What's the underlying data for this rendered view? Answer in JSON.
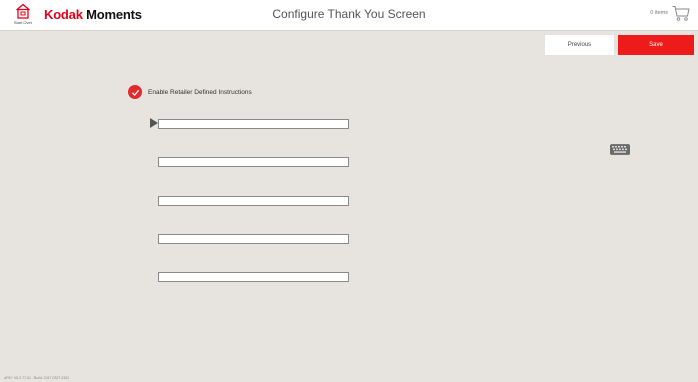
{
  "header": {
    "start_over_label": "Start Over",
    "brand_kodak": "Kodak",
    "brand_moments": "Moments",
    "title": "Configure Thank You Screen",
    "cart_count": "0 items"
  },
  "actions": {
    "previous_label": "Previous",
    "save_label": "Save"
  },
  "form": {
    "enable_label": "Enable Retailer Defined Instructions",
    "enable_checked": true,
    "instructions": [
      {
        "value": ""
      },
      {
        "value": ""
      },
      {
        "value": ""
      },
      {
        "value": ""
      },
      {
        "value": ""
      }
    ]
  },
  "footer": {
    "build_info": "APK+ V6.2.77.01 - Build: 2017.0327.2302"
  },
  "colors": {
    "accent": "#ee1b1b",
    "background": "#e7e4e0"
  },
  "icons": [
    "home-icon",
    "cart-icon",
    "checkmark-icon",
    "keyboard-icon",
    "pointer-icon"
  ]
}
